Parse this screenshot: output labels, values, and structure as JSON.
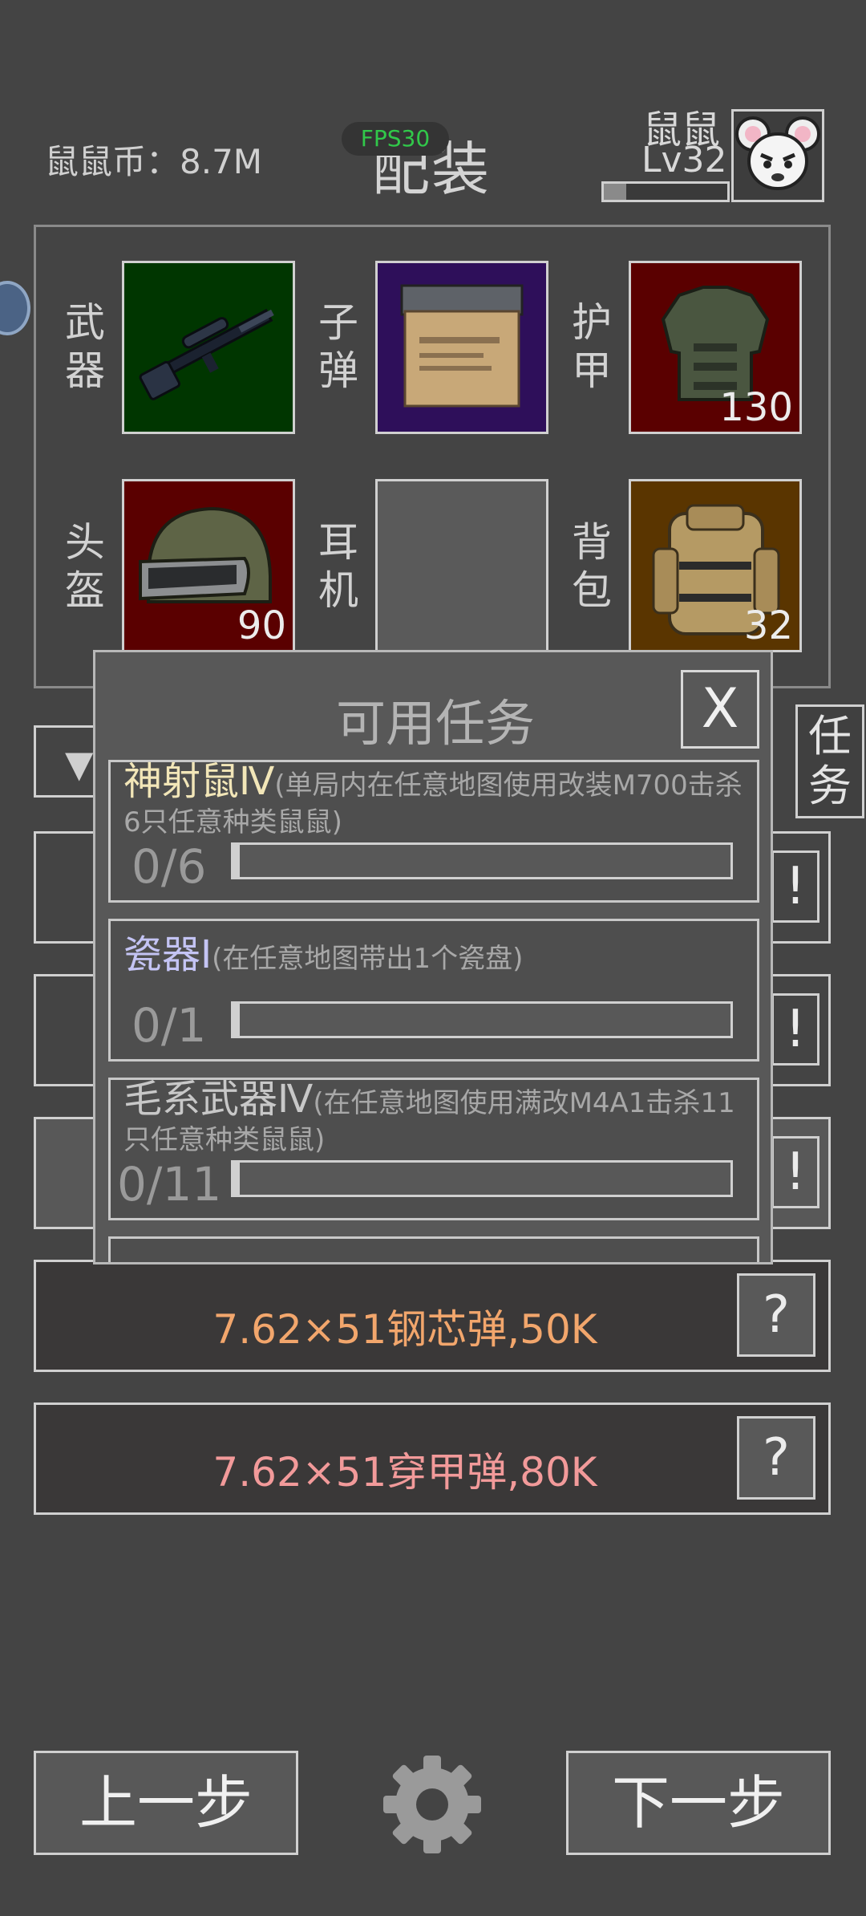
{
  "header": {
    "coins": "鼠鼠币：8.7M",
    "fps": "FPS30",
    "title": "配装",
    "player_name": "鼠鼠",
    "player_level": "Lv32",
    "xp_progress": 0.18
  },
  "equipment": [
    {
      "label": "武器",
      "icon": "rifle-icon",
      "bg": "#003600",
      "count": ""
    },
    {
      "label": "子弹",
      "icon": "ammo-box-icon",
      "bg": "#2e0f5a",
      "count": ""
    },
    {
      "label": "护甲",
      "icon": "body-armor-icon",
      "bg": "#5a0000",
      "count": "130"
    },
    {
      "label": "头盔",
      "icon": "helmet-icon",
      "bg": "#5a0000",
      "count": "90"
    },
    {
      "label": "耳机",
      "icon": "",
      "bg": "#5a5a5a",
      "count": ""
    },
    {
      "label": "背包",
      "icon": "backpack-icon",
      "bg": "#5a3500",
      "count": "32"
    }
  ],
  "side_tab": "任务",
  "dialog": {
    "title": "可用任务",
    "close_label": "X",
    "tasks": [
      {
        "name": "神射鼠Ⅳ",
        "name_color": "#f2e6b8",
        "desc": "(单局内在任意地图使用改装M700击杀6只任意种类鼠鼠)",
        "progress_text": "0/6",
        "progress": 0
      },
      {
        "name": "瓷器Ⅰ",
        "name_color": "#c4c4f4",
        "desc": "(在任意地图带出1个瓷盘)",
        "progress_text": "0/1",
        "progress": 0
      },
      {
        "name": "毛系武器Ⅳ",
        "name_color": "#c8c8c8",
        "desc": "(在任意地图使用满改M4A1击杀11只任意种类鼠鼠)",
        "progress_text": "0/11",
        "progress": 0
      }
    ]
  },
  "ammo_rows": [
    {
      "label": "7.62×51钢芯弹,50K",
      "color": "#f2a66c",
      "help": "?"
    },
    {
      "label": "7.62×51穿甲弹,80K",
      "color": "#f29a9a",
      "help": "?"
    }
  ],
  "bang_label": "!",
  "bottom": {
    "prev_label": "上一步",
    "next_label": "下一步"
  }
}
